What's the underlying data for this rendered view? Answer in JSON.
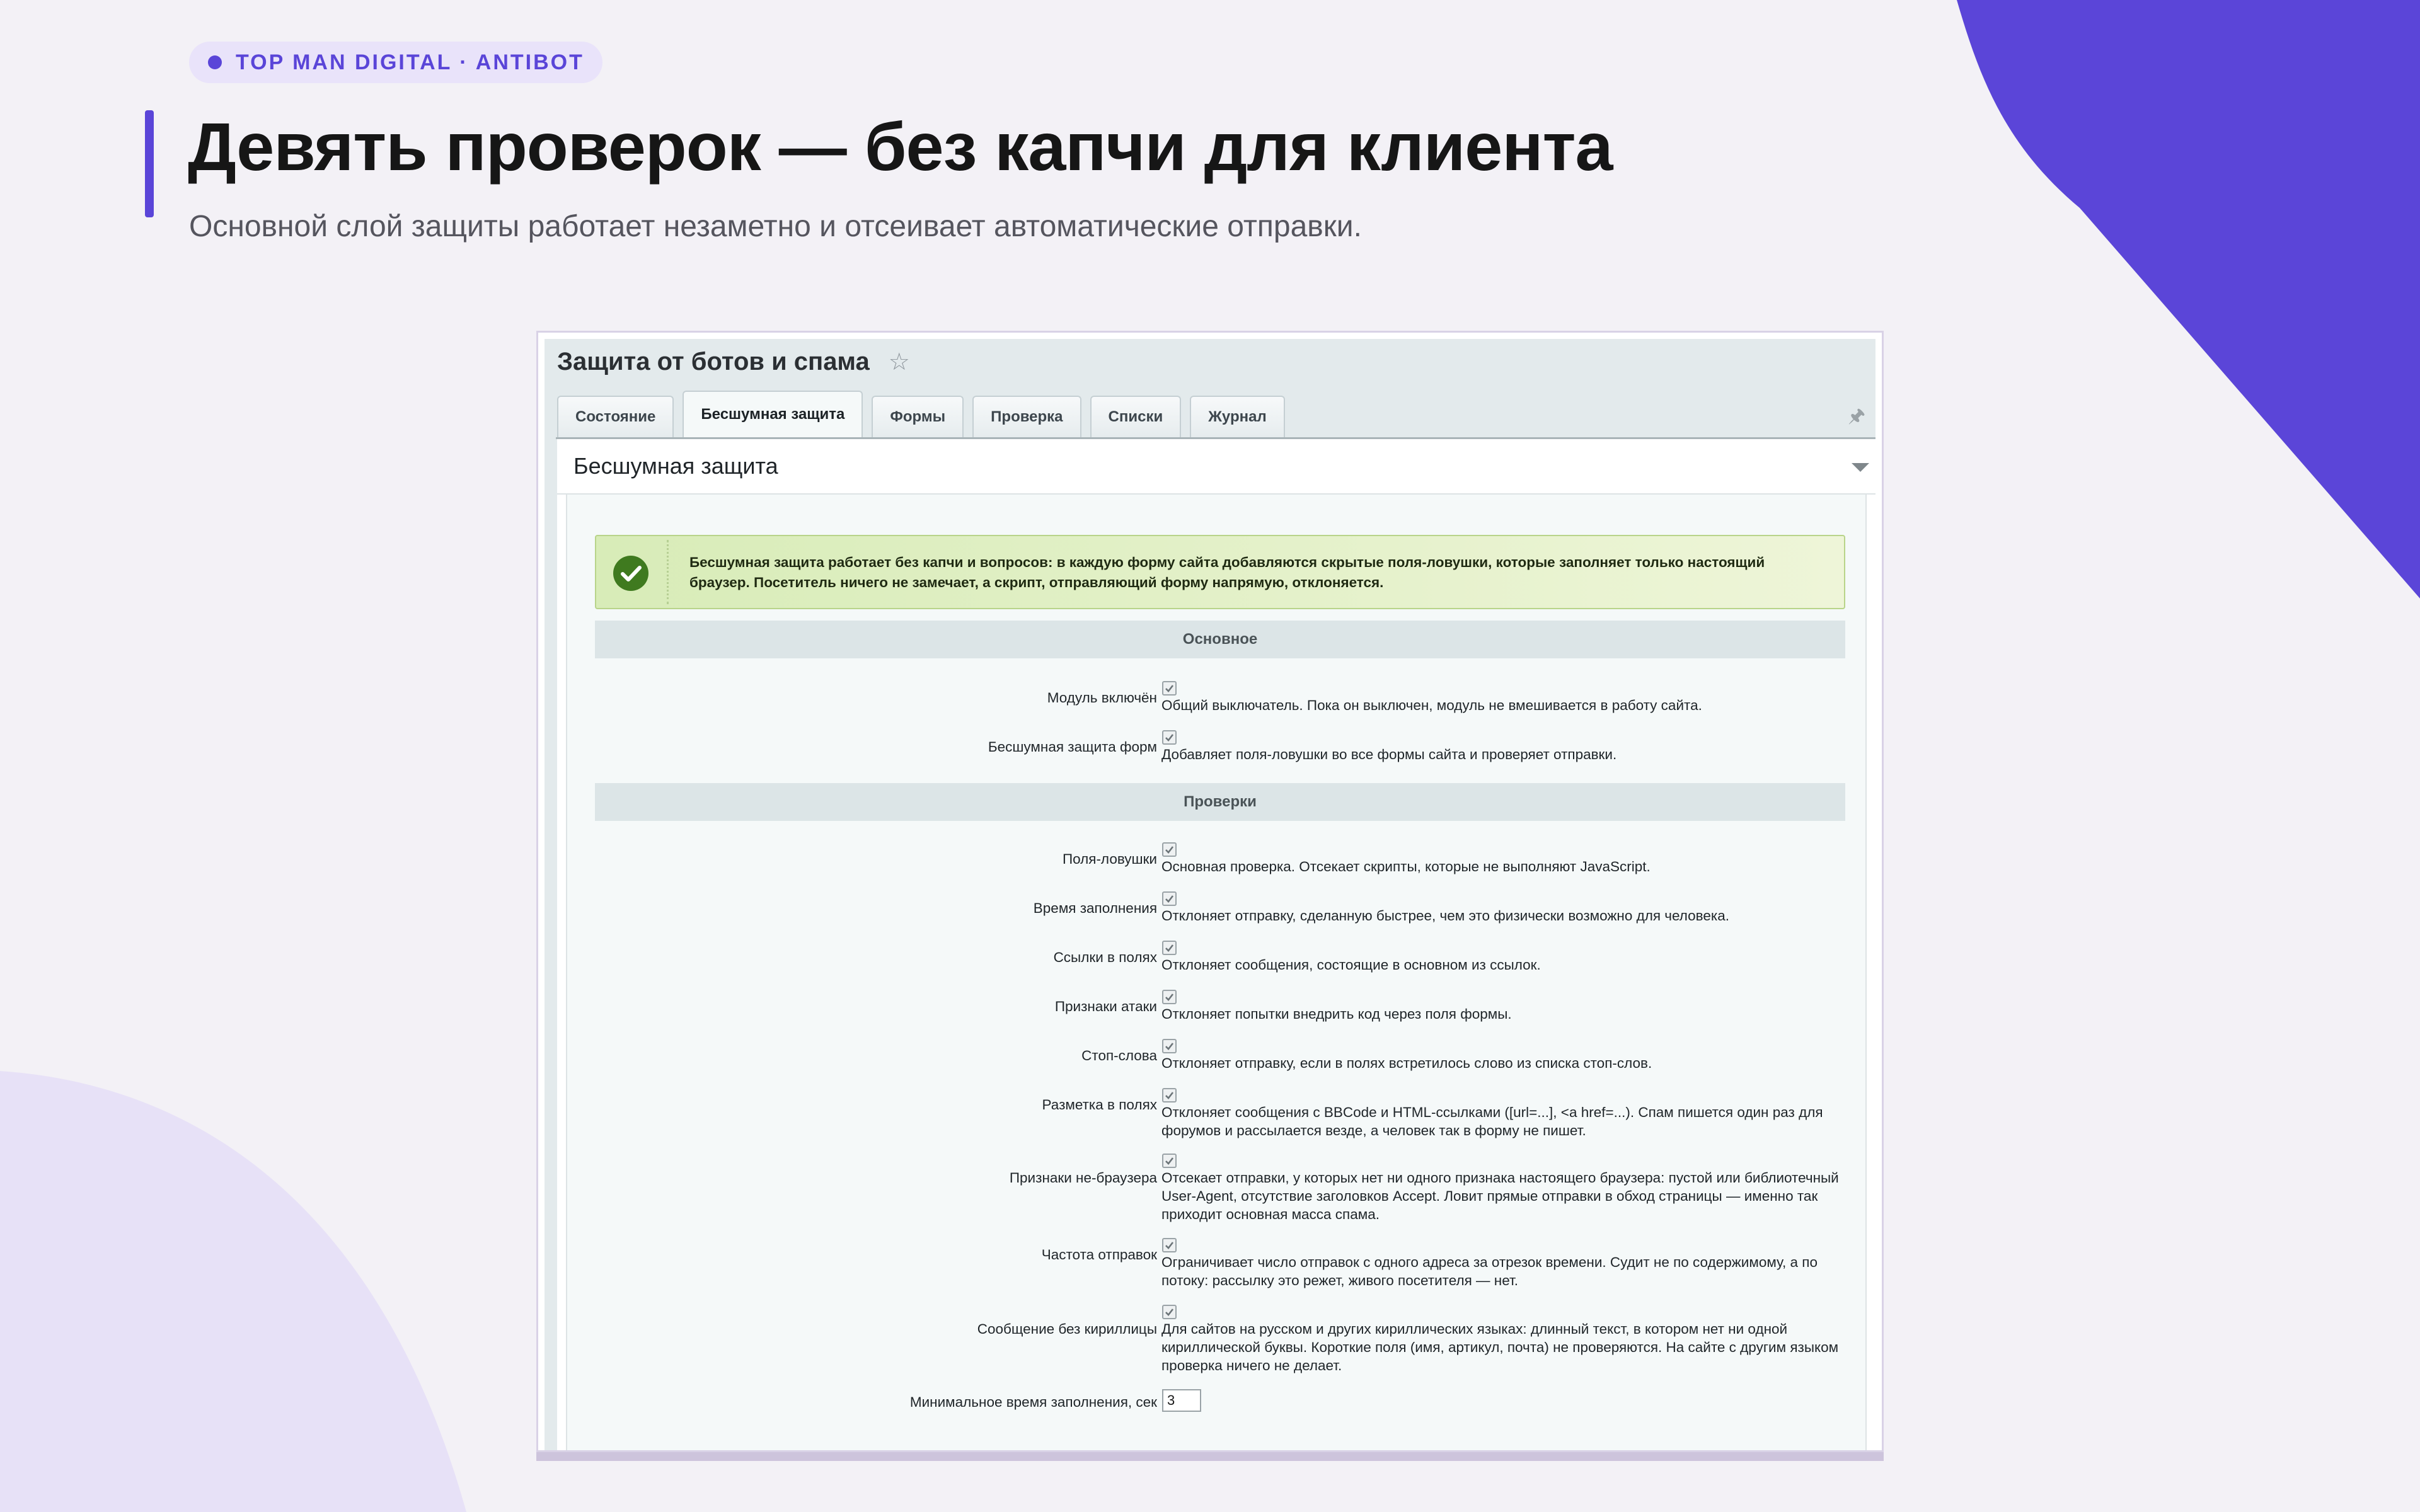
{
  "header": {
    "badge": "TOP MAN DIGITAL · ANTIBOT",
    "title": "Девять проверок — без капчи для клиента",
    "subtitle": "Основной слой защиты работает незаметно и отсеивает автоматические отправки."
  },
  "window": {
    "title": "Защита от ботов и спама",
    "tabs": [
      {
        "label": "Состояние",
        "active": false
      },
      {
        "label": "Бесшумная защита",
        "active": true
      },
      {
        "label": "Формы",
        "active": false
      },
      {
        "label": "Проверка",
        "active": false
      },
      {
        "label": "Списки",
        "active": false
      },
      {
        "label": "Журнал",
        "active": false
      }
    ],
    "panel_title": "Бесшумная защита",
    "note": "Бесшумная защита работает без капчи и вопросов: в каждую форму сайта добавляются скрытые поля-ловушки, которые заполняет только настоящий браузер. Посетитель ничего не замечает, а скрипт, отправляющий форму напрямую, отклоняется.",
    "sections": {
      "main": {
        "title": "Основное",
        "rows": [
          {
            "label": "Модуль включён",
            "desc": "Общий выключатель. Пока он выключен, модуль не вмешивается в работу сайта.",
            "checked": true
          },
          {
            "label": "Бесшумная защита форм",
            "desc": "Добавляет поля-ловушки во все формы сайта и проверяет отправки.",
            "checked": true
          }
        ]
      },
      "checks": {
        "title": "Проверки",
        "rows": [
          {
            "label": "Поля-ловушки",
            "desc": "Основная проверка. Отсекает скрипты, которые не выполняют JavaScript.",
            "checked": true
          },
          {
            "label": "Время заполнения",
            "desc": "Отклоняет отправку, сделанную быстрее, чем это физически возможно для человека.",
            "checked": true
          },
          {
            "label": "Ссылки в полях",
            "desc": "Отклоняет сообщения, состоящие в основном из ссылок.",
            "checked": true
          },
          {
            "label": "Признаки атаки",
            "desc": "Отклоняет попытки внедрить код через поля формы.",
            "checked": true
          },
          {
            "label": "Стоп-слова",
            "desc": "Отклоняет отправку, если в полях встретилось слово из списка стоп-слов.",
            "checked": true
          },
          {
            "label": "Разметка в полях",
            "desc": "Отклоняет сообщения с BBCode и HTML-ссылками ([url=...], <a href=...). Спам пишется один раз для форумов и рассылается везде, а человек так в форму не пишет.",
            "checked": true
          },
          {
            "label": "Признаки не-браузера",
            "desc": "Отсекает отправки, у которых нет ни одного признака настоящего браузера: пустой или библиотечный User-Agent, отсутствие заголовков Accept. Ловит прямые отправки в обход страницы — именно так приходит основная масса спама.",
            "checked": true
          },
          {
            "label": "Частота отправок",
            "desc": "Ограничивает число отправок с одного адреса за отрезок времени. Судит не по содержимому, а по потоку: рассылку это режет, живого посетителя — нет.",
            "checked": true
          },
          {
            "label": "Сообщение без кириллицы",
            "desc": "Для сайтов на русском и других кириллических языках: длинный текст, в котором нет ни одной кириллической буквы. Короткие поля (имя, артикул, почта) не проверяются. На сайте с другим языком проверка ничего не делает.",
            "checked": true
          }
        ]
      }
    },
    "min_time": {
      "label": "Минимальное время заполнения, сек",
      "value": "3"
    }
  },
  "colors": {
    "accent": "#5a45d8",
    "background": "#f3f1f6",
    "note_green": "#d8ecb8",
    "check_green": "#3f7a1f"
  }
}
